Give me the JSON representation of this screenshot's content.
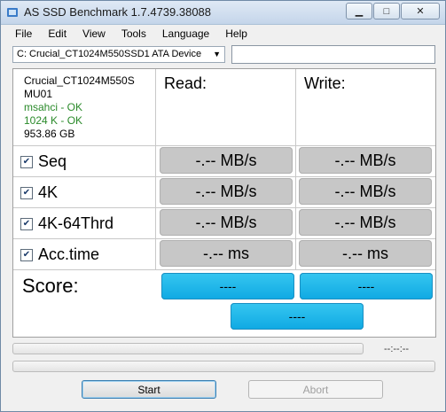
{
  "window": {
    "title": "AS SSD Benchmark 1.7.4739.38088"
  },
  "menu": [
    "File",
    "Edit",
    "View",
    "Tools",
    "Language",
    "Help"
  ],
  "device": {
    "selected": "C: Crucial_CT1024M550SSD1 ATA Device"
  },
  "drive_info": {
    "model": "Crucial_CT1024M550S",
    "firmware": "MU01",
    "driver_status": "msahci - OK",
    "alignment_status": "1024 K - OK",
    "size": "953.86 GB"
  },
  "columns": {
    "read": "Read:",
    "write": "Write:"
  },
  "rows": [
    {
      "label": "Seq",
      "checked": true,
      "read": "-.-- MB/s",
      "write": "-.-- MB/s"
    },
    {
      "label": "4K",
      "checked": true,
      "read": "-.-- MB/s",
      "write": "-.-- MB/s"
    },
    {
      "label": "4K-64Thrd",
      "checked": true,
      "read": "-.-- MB/s",
      "write": "-.-- MB/s"
    },
    {
      "label": "Acc.time",
      "checked": true,
      "read": "-.-- ms",
      "write": "-.-- ms"
    }
  ],
  "score": {
    "label": "Score:",
    "read": "----",
    "write": "----",
    "total": "----"
  },
  "progress": {
    "timer": "--:--:--"
  },
  "buttons": {
    "start": "Start",
    "abort": "Abort"
  },
  "colors": {
    "result_bg": "#c7c7c7",
    "score_bg": "#1fb5ea",
    "ok_text": "#2a8a2a"
  }
}
